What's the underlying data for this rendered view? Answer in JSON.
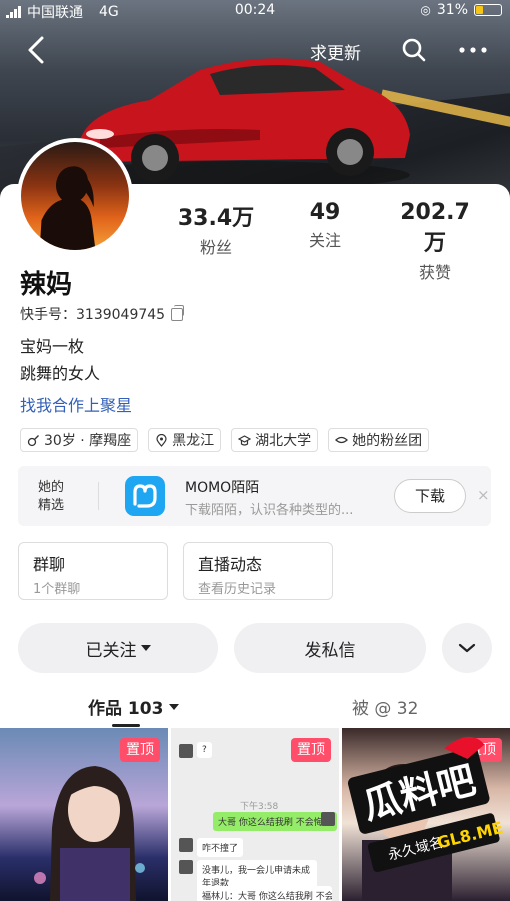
{
  "status_bar": {
    "carrier": "中国联通",
    "network": "4G",
    "time": "00:24",
    "battery": "31%",
    "battery_level": 0.31
  },
  "nav": {
    "update_text": "求更新"
  },
  "profile": {
    "name": "辣妈",
    "kuaishou_id": "快手号：3139049745",
    "bio_lines": [
      "宝妈一枚",
      "跳舞的女人"
    ],
    "cooperate_link": "找我合作上聚星",
    "stats": [
      {
        "value": "33.4万",
        "label": "粉丝"
      },
      {
        "value": "49",
        "label": "关注"
      },
      {
        "value": "202.7万",
        "label": "获赞"
      }
    ],
    "tags": [
      "30岁 · 摩羯座",
      "黑龙江",
      "湖北大学",
      "她的粉丝团"
    ]
  },
  "recommend": {
    "label": "她的精选",
    "app_name": "MOMO陌陌",
    "app_desc": "下载陌陌，认识各种类型的...",
    "download_label": "下载",
    "close": "×"
  },
  "boxes": [
    {
      "title": "群聊",
      "sub": "1个群聊"
    },
    {
      "title": "直播动态",
      "sub": "查看历史记录"
    }
  ],
  "actions": {
    "followed": "已关注",
    "message": "发私信"
  },
  "tabs": {
    "works": "作品 103",
    "mentioned": "被 @ 32"
  },
  "grid": {
    "pin_label": "置顶",
    "chat_texts": [
      "?",
      "下午3:58",
      "大哥 你这么结我刷 不会悔吗",
      "咋不撞了",
      "没事儿，我一会儿申请未成年退款",
      "福林儿：大哥 你这么结我刷 不会悔吗"
    ]
  },
  "watermark": {
    "brand": "瓜料吧",
    "tagline": "永久域名",
    "domain": "GL8.ME"
  },
  "colors": {
    "link": "#3460b8",
    "pin": "#ff4d6a",
    "app_icon": "#1fa6f2"
  }
}
